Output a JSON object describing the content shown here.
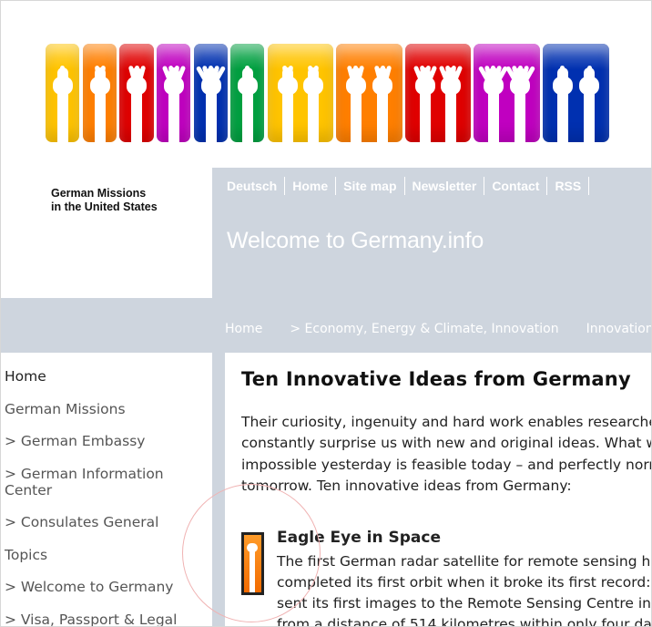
{
  "header": {
    "logo_line1": "German Missions",
    "logo_line2": "in the United States",
    "site_title": "Welcome to Germany.info"
  },
  "top_nav": [
    "Deutsch",
    "Home",
    "Site map",
    "Newsletter",
    "Contact",
    "RSS"
  ],
  "breadcrumb": [
    "Home",
    "> Economy, Energy & Climate, Innovation",
    "Innovation"
  ],
  "sidebar": [
    "Home",
    "German Missions",
    "> German Embassy",
    "> German Information",
    "Center",
    "> Consulates General",
    "Topics",
    "> Welcome to Germany",
    "> Visa, Passport & Legal"
  ],
  "article": {
    "title": "Ten Innovative Ideas from Germany",
    "intro_lines": [
      "Their curiosity, ingenuity and hard work enables researchers",
      "constantly surprise us with new and original ideas. What was",
      "impossible yesterday is feasible today – and perfectly normal",
      "tomorrow. Ten innovative ideas from Germany:"
    ],
    "sub_title": "Eagle Eye in Space",
    "sub_lines": [
      "The first German radar satellite for remote sensing had",
      "completed its first orbit when it broke its first record: T",
      "sent its first images to the Remote Sensing Centre in N",
      "from a distance of 514 kilometres within only four days. Th"
    ]
  },
  "banner_colors": [
    "#ffc400",
    "#ff7f00",
    "#e00000",
    "#c000c0",
    "#0030b0",
    "#00a040",
    "#ffc400",
    "#ff7f00",
    "#e00000",
    "#c000c0",
    "#0030b0"
  ]
}
